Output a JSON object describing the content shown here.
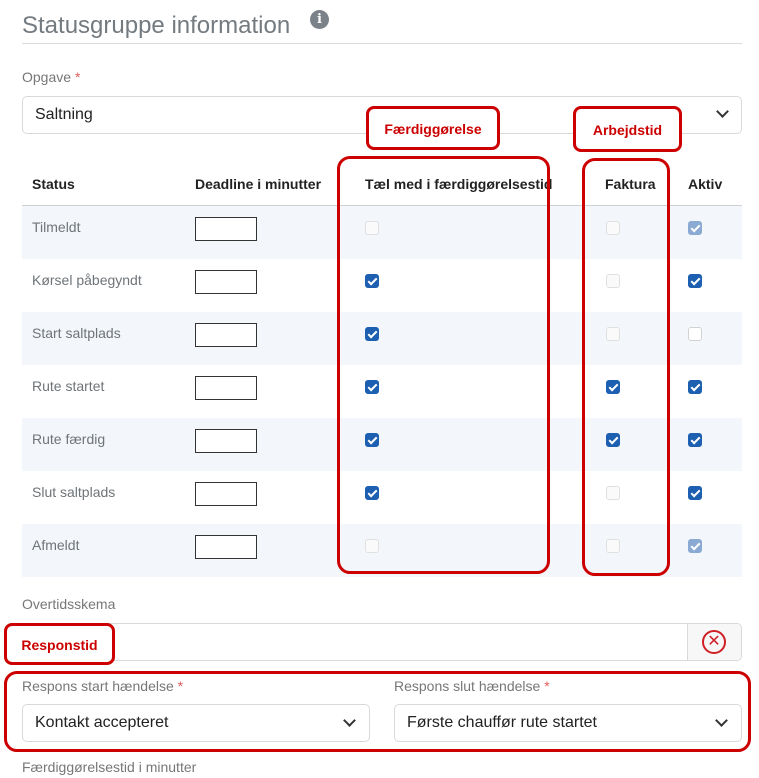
{
  "header": {
    "title": "Statusgruppe information",
    "info_icon": "info-circle-icon"
  },
  "opgave": {
    "label": "Opgave",
    "required_mark": "*",
    "value": "Saltning"
  },
  "table": {
    "headers": {
      "status": "Status",
      "deadline": "Deadline i minutter",
      "completion": "Tæl med i færdiggørelsestid",
      "invoice": "Faktura",
      "active": "Aktiv"
    },
    "rows": [
      {
        "label": "Tilmeldt",
        "completion": false,
        "completion_disabled": true,
        "invoice": false,
        "invoice_disabled": true,
        "active": true,
        "active_disabled": true
      },
      {
        "label": "Kørsel påbegyndt",
        "completion": true,
        "completion_disabled": false,
        "invoice": false,
        "invoice_disabled": true,
        "active": true,
        "active_disabled": false
      },
      {
        "label": "Start saltplads",
        "completion": true,
        "completion_disabled": false,
        "invoice": false,
        "invoice_disabled": true,
        "active": false,
        "active_disabled": false
      },
      {
        "label": "Rute startet",
        "completion": true,
        "completion_disabled": false,
        "invoice": true,
        "invoice_disabled": false,
        "active": true,
        "active_disabled": false
      },
      {
        "label": "Rute færdig",
        "completion": true,
        "completion_disabled": false,
        "invoice": true,
        "invoice_disabled": false,
        "active": true,
        "active_disabled": false
      },
      {
        "label": "Slut saltplads",
        "completion": true,
        "completion_disabled": false,
        "invoice": false,
        "invoice_disabled": true,
        "active": true,
        "active_disabled": false
      },
      {
        "label": "Afmeldt",
        "completion": false,
        "completion_disabled": true,
        "invoice": false,
        "invoice_disabled": true,
        "active": true,
        "active_disabled": true
      }
    ]
  },
  "overtid": {
    "label": "Overtidsskema",
    "value": "",
    "clear_icon": "close-circle-icon"
  },
  "respons_start": {
    "label": "Respons start hændelse",
    "required_mark": "*",
    "value": "Kontakt accepteret"
  },
  "respons_slut": {
    "label": "Respons slut hændelse",
    "required_mark": "*",
    "value": "Første chauffør rute startet"
  },
  "bottom_label": "Færdiggørelsestid i minutter",
  "annotations": {
    "completion": "Færdiggørelse",
    "worktime": "Arbejdstid",
    "response": "Responstid",
    "color": "#cc0000"
  },
  "colors": {
    "checkbox_checked": "#1d5fb0",
    "annotation": "#cc0000",
    "clear": "#cf2026"
  }
}
